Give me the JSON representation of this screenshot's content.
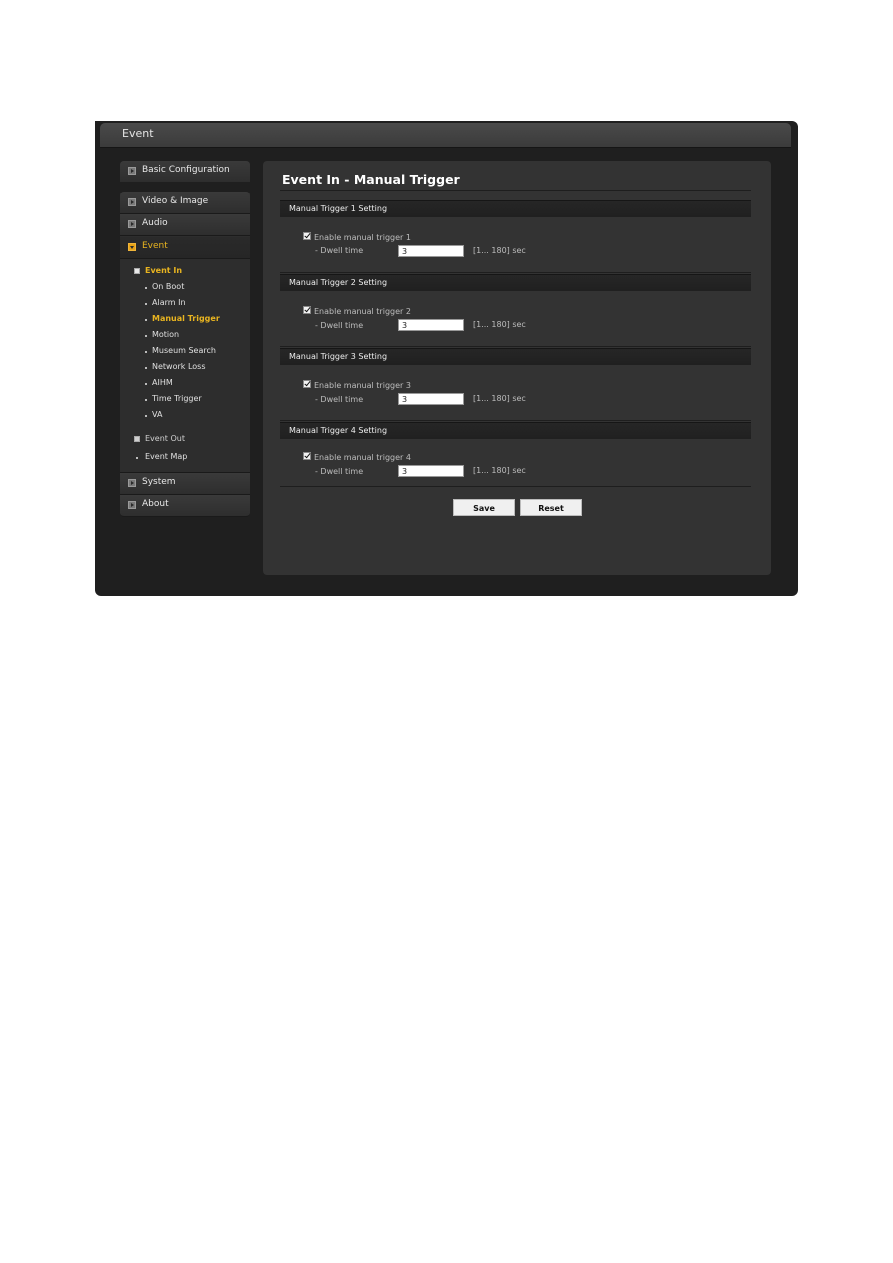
{
  "window": {
    "title": "Event"
  },
  "sidebar": {
    "basic_configuration": "Basic Configuration",
    "video_image": "Video & Image",
    "audio": "Audio",
    "event": "Event",
    "event_in": {
      "label": "Event In",
      "items": [
        "On Boot",
        "Alarm In",
        "Manual Trigger",
        "Motion",
        "Museum Search",
        "Network Loss",
        "AIHM",
        "Time Trigger",
        "VA"
      ],
      "active": "Manual Trigger"
    },
    "event_out": "Event Out",
    "event_map": "Event Map",
    "system": "System",
    "about": "About"
  },
  "main": {
    "title": "Event In - Manual Trigger",
    "sections": [
      {
        "heading": "Manual Trigger 1 Setting",
        "enable_label": "Enable manual trigger 1",
        "enabled": true,
        "dwell_label": "- Dwell time",
        "dwell_value": "3",
        "range": "[1... 180] sec"
      },
      {
        "heading": "Manual Trigger 2 Setting",
        "enable_label": "Enable manual trigger 2",
        "enabled": true,
        "dwell_label": "- Dwell time",
        "dwell_value": "3",
        "range": "[1... 180] sec"
      },
      {
        "heading": "Manual Trigger 3 Setting",
        "enable_label": "Enable manual trigger 3",
        "enabled": true,
        "dwell_label": "- Dwell time",
        "dwell_value": "3",
        "range": "[1... 180] sec"
      },
      {
        "heading": "Manual Trigger 4 Setting",
        "enable_label": "Enable manual trigger 4",
        "enabled": true,
        "dwell_label": "- Dwell time",
        "dwell_value": "3",
        "range": "[1... 180] sec"
      }
    ],
    "save_label": "Save",
    "reset_label": "Reset"
  },
  "colors": {
    "accent": "#e8b420",
    "background": "#1f1f1f",
    "panel": "#333333"
  }
}
